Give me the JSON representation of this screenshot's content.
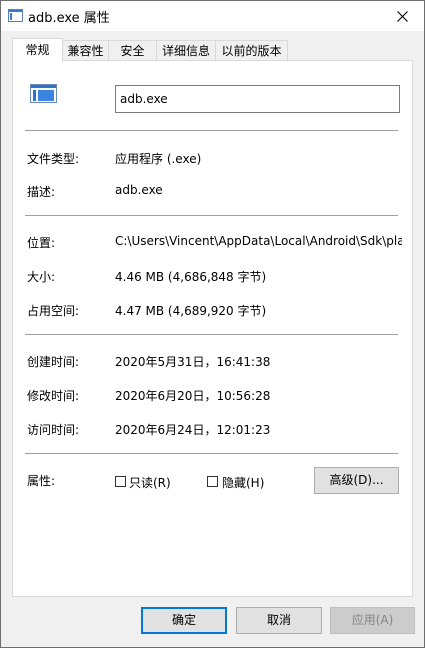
{
  "window": {
    "title": "adb.exe 属性"
  },
  "tabs": [
    {
      "label": "常规",
      "active": true
    },
    {
      "label": "兼容性"
    },
    {
      "label": "安全"
    },
    {
      "label": "详细信息"
    },
    {
      "label": "以前的版本"
    }
  ],
  "general": {
    "file_name": "adb.exe",
    "file_type_label": "文件类型:",
    "file_type_value": "应用程序 (.exe)",
    "description_label": "描述:",
    "description_value": "adb.exe",
    "location_label": "位置:",
    "location_value": "C:\\Users\\Vincent\\AppData\\Local\\Android\\Sdk\\pla",
    "size_label": "大小:",
    "size_value": "4.46 MB (4,686,848 字节)",
    "size_on_disk_label": "占用空间:",
    "size_on_disk_value": "4.47 MB (4,689,920 字节)",
    "created_label": "创建时间:",
    "created_value": "2020年5月31日，16:41:38",
    "modified_label": "修改时间:",
    "modified_value": "2020年6月20日，10:56:28",
    "accessed_label": "访问时间:",
    "accessed_value": "2020年6月24日，12:01:23",
    "attributes_label": "属性:",
    "readonly_label": "只读(R)",
    "hidden_label": "隐藏(H)",
    "advanced_label": "高级(D)..."
  },
  "buttons": {
    "ok": "确定",
    "cancel": "取消",
    "apply": "应用(A)"
  },
  "colors": {
    "accent": "#0078d7"
  }
}
